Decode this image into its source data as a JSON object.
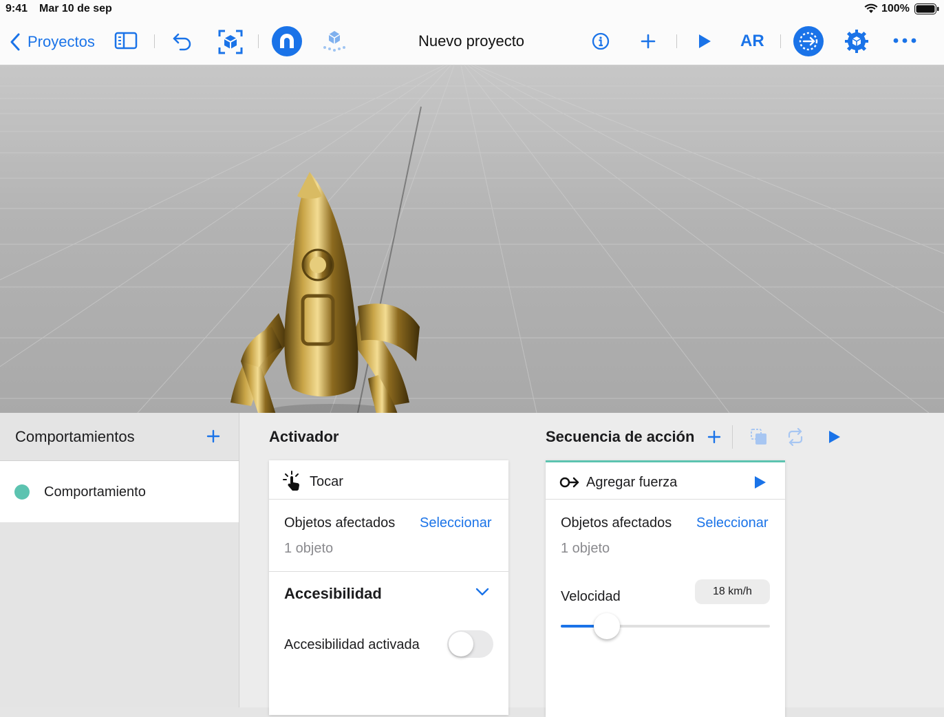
{
  "status": {
    "time": "9:41",
    "date": "Mar 10 de sep",
    "battery": "100%"
  },
  "toolbar": {
    "back_label": "Proyectos",
    "title": "Nuevo proyecto",
    "ar_label": "AR",
    "accent": "#1a73e8"
  },
  "behaviors": {
    "header": "Comportamientos",
    "add_label": "+",
    "items": [
      {
        "label": "Comportamiento",
        "color": "#5cc3b0"
      }
    ]
  },
  "trigger": {
    "header": "Activador",
    "card_title": "Tocar",
    "affected_label": "Objetos afectados",
    "select_label": "Seleccionar",
    "count": "1 objeto",
    "accessibility_title": "Accesibilidad",
    "accessibility_toggle_label": "Accesibilidad activada",
    "accessibility_enabled": false
  },
  "sequence": {
    "header": "Secuencia de acción",
    "add_label": "+",
    "card_title": "Agregar fuerza",
    "affected_label": "Objetos afectados",
    "select_label": "Seleccionar",
    "count": "1 objeto",
    "velocity_label": "Velocidad",
    "velocity_value": "18 km/h",
    "slider_fraction": 0.22
  }
}
